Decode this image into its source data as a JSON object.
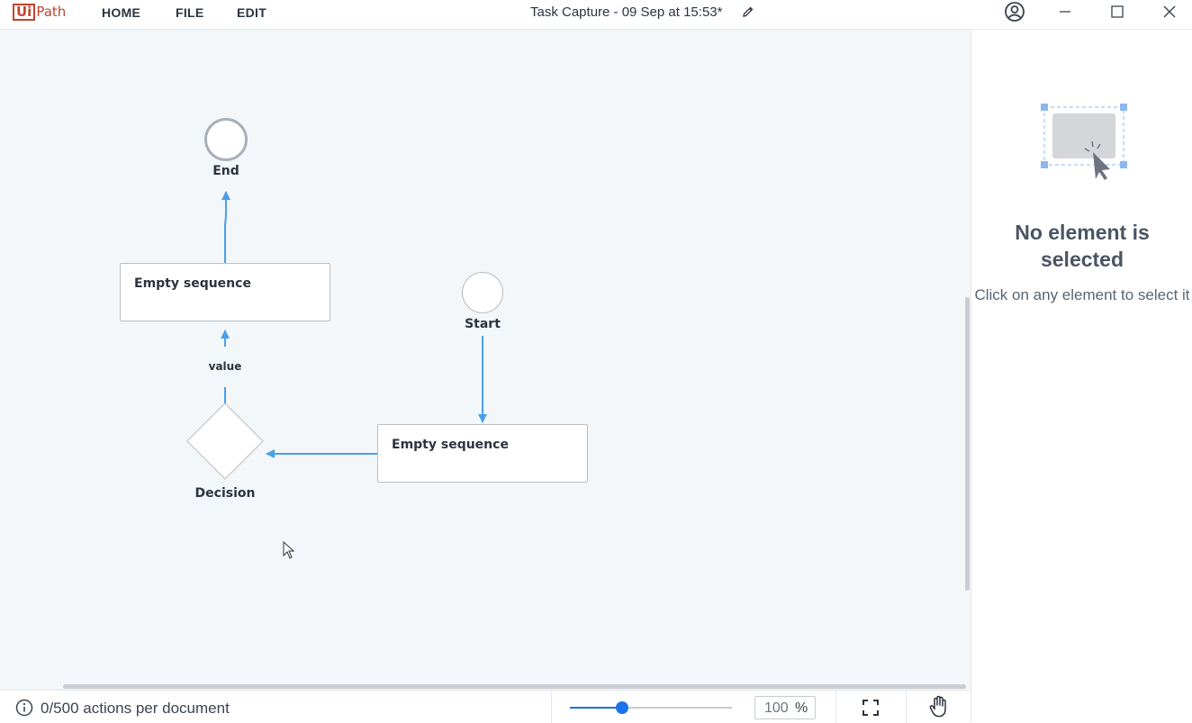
{
  "app": {
    "brand_ui": "Ui",
    "brand_path": "Path",
    "document_title": "Task Capture - 09 Sep at 15:53*"
  },
  "menu": [
    {
      "label": "HOME"
    },
    {
      "label": "FILE"
    },
    {
      "label": "EDIT"
    }
  ],
  "diagram": {
    "nodes": {
      "end": "End",
      "start": "Start",
      "decision": "Decision",
      "sequence_top": "Empty sequence",
      "sequence_right": "Empty sequence"
    },
    "edge_label": "value"
  },
  "panel": {
    "title": "No element is selected",
    "subtitle": "Click on any element to select it"
  },
  "status": {
    "actions_text": "0/500 actions per document",
    "zoom_value": "100",
    "zoom_unit": "%",
    "zoom_fraction": 0.32
  },
  "colors": {
    "accent": "#1a73e8",
    "connector": "#4a9fe8",
    "brand": "#c1442f",
    "canvas_bg": "#f4f7fa"
  },
  "icons": [
    "pencil-icon",
    "user-account-icon",
    "minimize-icon",
    "maximize-icon",
    "close-icon",
    "info-icon",
    "fit-screen-icon",
    "hand-pan-icon",
    "selection-placeholder-icon",
    "mouse-cursor-icon"
  ]
}
